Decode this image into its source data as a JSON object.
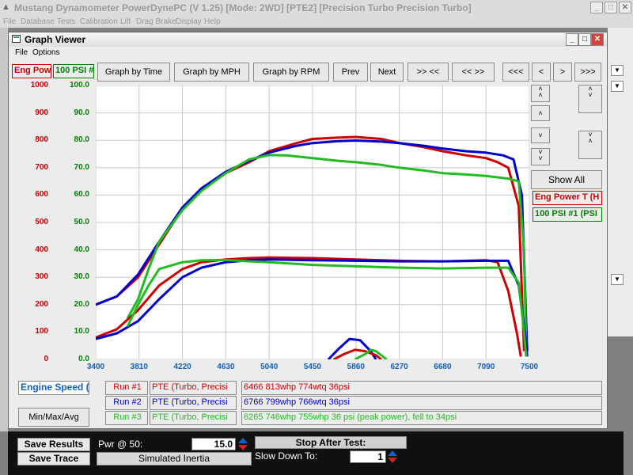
{
  "app": {
    "title": "Mustang Dynamometer PowerDynePC (V 1.25) [Mode: 2WD] [PTE2] [Precision Turbo Precision Turbo]",
    "menu": [
      "File",
      "Database",
      "Tests",
      "Calibration",
      "Lift",
      "Drag Brake",
      "Display",
      "Help"
    ]
  },
  "graph_viewer": {
    "title": "Graph Viewer",
    "menu": [
      "File",
      "Options"
    ],
    "left_channel": "Eng Pow",
    "right_channel": "100 PSI #",
    "nav_buttons": [
      "Graph by Time",
      "Graph by MPH",
      "Graph by RPM",
      "Prev",
      "Next",
      ">> <<",
      "<< >>",
      "<<<",
      "<",
      ">",
      ">>>"
    ],
    "show_all": "Show All",
    "legend_red": "Eng Power T (H",
    "legend_green": "100 PSI #1 (PSI",
    "x_channel": "Engine Speed (F",
    "minmax": "Min/Max/Avg"
  },
  "runs": [
    {
      "label": "Run #1",
      "name": "PTE (Turbo, Precisi",
      "summary": "6466 813whp 774wtq 36psi",
      "color": "#cc0000"
    },
    {
      "label": "Run #2",
      "name": "PTE (Turbo, Precisi",
      "summary": "6766 799whp 766wtq 36psi",
      "color": "#0000cc"
    },
    {
      "label": "Run #3",
      "name": "PTE (Turbo, Precisi",
      "summary": "6265 746whp 755whp 36 psi (peak power), fell to 34psi",
      "color": "#22bb22"
    }
  ],
  "bottom": {
    "save_results": "Save Results",
    "save_trace": "Save Trace",
    "pwr_label": "Pwr @ 50:",
    "pwr_value": "15.0",
    "simulated_inertia": "Simulated Inertia",
    "stop_after_test": "Stop After Test:",
    "slow_down_label": "Slow Down To:",
    "slow_down_value": "1"
  },
  "chart_data": {
    "type": "line",
    "x_ticks": [
      "3400",
      "3810",
      "4220",
      "4630",
      "5040",
      "5450",
      "5860",
      "6270",
      "6680",
      "7090",
      "7500"
    ],
    "xlim": [
      3400,
      7500
    ],
    "y_left_ticks": [
      "0",
      "100",
      "200",
      "300",
      "400",
      "500",
      "600",
      "700",
      "800",
      "900",
      "1000"
    ],
    "y_right_ticks": [
      "0.0",
      "10.0",
      "20.0",
      "30.0",
      "40.0",
      "50.0",
      "60.0",
      "70.0",
      "80.0",
      "90.0",
      "100.0"
    ],
    "ylim_left": [
      0,
      1000
    ],
    "ylim_right": [
      0,
      100
    ],
    "grid": true,
    "series": [
      {
        "color": "#cc0000",
        "axis": "left",
        "x": [
          3400,
          3600,
          3800,
          4000,
          4220,
          4400,
          4630,
          4850,
          5040,
          5300,
          5450,
          5700,
          5860,
          6100,
          6270,
          6500,
          6680,
          6900,
          7090,
          7200,
          7300,
          7400,
          7450
        ],
        "values": [
          200,
          230,
          300,
          420,
          550,
          620,
          680,
          720,
          760,
          790,
          805,
          810,
          812,
          805,
          790,
          775,
          760,
          745,
          735,
          720,
          700,
          560,
          30
        ]
      },
      {
        "color": "#0000cc",
        "axis": "left",
        "x": [
          3400,
          3600,
          3800,
          4000,
          4220,
          4400,
          4630,
          4850,
          5040,
          5300,
          5450,
          5700,
          5860,
          6100,
          6270,
          6500,
          6680,
          6900,
          7090,
          7250,
          7350,
          7430,
          7480
        ],
        "values": [
          200,
          230,
          310,
          430,
          555,
          625,
          685,
          725,
          755,
          780,
          790,
          797,
          799,
          795,
          790,
          780,
          770,
          760,
          755,
          745,
          730,
          600,
          30
        ]
      },
      {
        "color": "#22bb22",
        "axis": "left",
        "x": [
          3700,
          3800,
          3900,
          4000,
          4220,
          4400,
          4630,
          4850,
          5040,
          5200,
          5450,
          5700,
          5860,
          6100,
          6270,
          6500,
          6680,
          6900,
          7090,
          7300,
          7400,
          7450,
          7470
        ],
        "values": [
          150,
          220,
          330,
          430,
          545,
          615,
          680,
          730,
          746,
          745,
          735,
          725,
          720,
          710,
          700,
          690,
          680,
          675,
          670,
          660,
          650,
          400,
          30
        ]
      },
      {
        "color": "#cc0000",
        "axis": "left",
        "x": [
          3400,
          3600,
          3800,
          4000,
          4220,
          4400,
          4630,
          4850,
          5040,
          5450,
          5860,
          6270,
          6680,
          7090,
          7200,
          7300,
          7380,
          7420
        ],
        "values": [
          80,
          110,
          180,
          270,
          330,
          355,
          365,
          370,
          372,
          370,
          365,
          360,
          358,
          362,
          355,
          250,
          100,
          10
        ]
      },
      {
        "color": "#0000cc",
        "axis": "left",
        "x": [
          3400,
          3600,
          3800,
          4000,
          4220,
          4400,
          4630,
          4850,
          5040,
          5450,
          5860,
          6270,
          6680,
          7090,
          7300,
          7400,
          7460,
          7480
        ],
        "values": [
          75,
          95,
          140,
          220,
          300,
          335,
          355,
          362,
          365,
          362,
          360,
          358,
          358,
          360,
          360,
          270,
          90,
          10
        ]
      },
      {
        "color": "#22bb22",
        "axis": "left",
        "x": [
          3700,
          3800,
          3900,
          4000,
          4220,
          4400,
          4630,
          4850,
          5040,
          5450,
          5860,
          6270,
          6680,
          7090,
          7300,
          7400,
          7450,
          7470
        ],
        "values": [
          120,
          200,
          270,
          330,
          355,
          362,
          363,
          358,
          355,
          345,
          340,
          335,
          332,
          335,
          335,
          280,
          100,
          10
        ]
      },
      {
        "color": "#0000cc",
        "axis": "left",
        "x": [
          5600,
          5700,
          5800,
          5900,
          6000,
          6050
        ],
        "values": [
          0,
          40,
          75,
          70,
          30,
          0
        ]
      },
      {
        "color": "#cc0000",
        "axis": "left",
        "x": [
          5650,
          5750,
          5850,
          5950,
          6050,
          6100
        ],
        "values": [
          0,
          20,
          35,
          30,
          15,
          0
        ]
      },
      {
        "color": "#22bb22",
        "axis": "left",
        "x": [
          5850,
          5950,
          6000,
          6050,
          6100,
          6150
        ],
        "values": [
          0,
          20,
          35,
          30,
          15,
          0
        ]
      }
    ]
  }
}
